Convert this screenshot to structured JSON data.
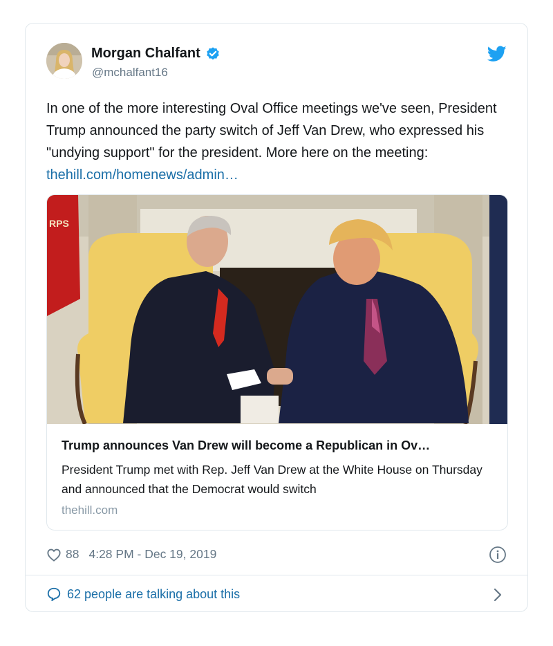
{
  "tweet": {
    "author_name": "Morgan Chalfant",
    "author_handle": "@mchalfant16",
    "text_before_link": "In one of the more interesting Oval Office meetings we've seen, President Trump announced the party switch of Jeff Van Drew, who expressed his \"undying support\" for the president. More here on the meeting: ",
    "link_text": "thehill.com/homenews/admin…",
    "likes": "88",
    "timestamp": "4:28 PM - Dec 19, 2019",
    "talking_text": "62 people are talking about this",
    "photo_flag_text": "RPS"
  },
  "link_card": {
    "title": "Trump announces Van Drew will become a Republican in Ov…",
    "description": "President Trump met with Rep. Jeff Van Drew at the White House on Thursday and announced that the Democrat would switch",
    "domain": "thehill.com"
  },
  "colors": {
    "link_blue": "#1b6fa8",
    "twitter_blue": "#1da1f2",
    "secondary_text": "#657786",
    "border": "#e1e8ed"
  },
  "icons": [
    "verified-badge-icon",
    "twitter-bird-icon",
    "heart-icon",
    "info-icon",
    "speech-bubble-icon",
    "chevron-right-icon"
  ]
}
